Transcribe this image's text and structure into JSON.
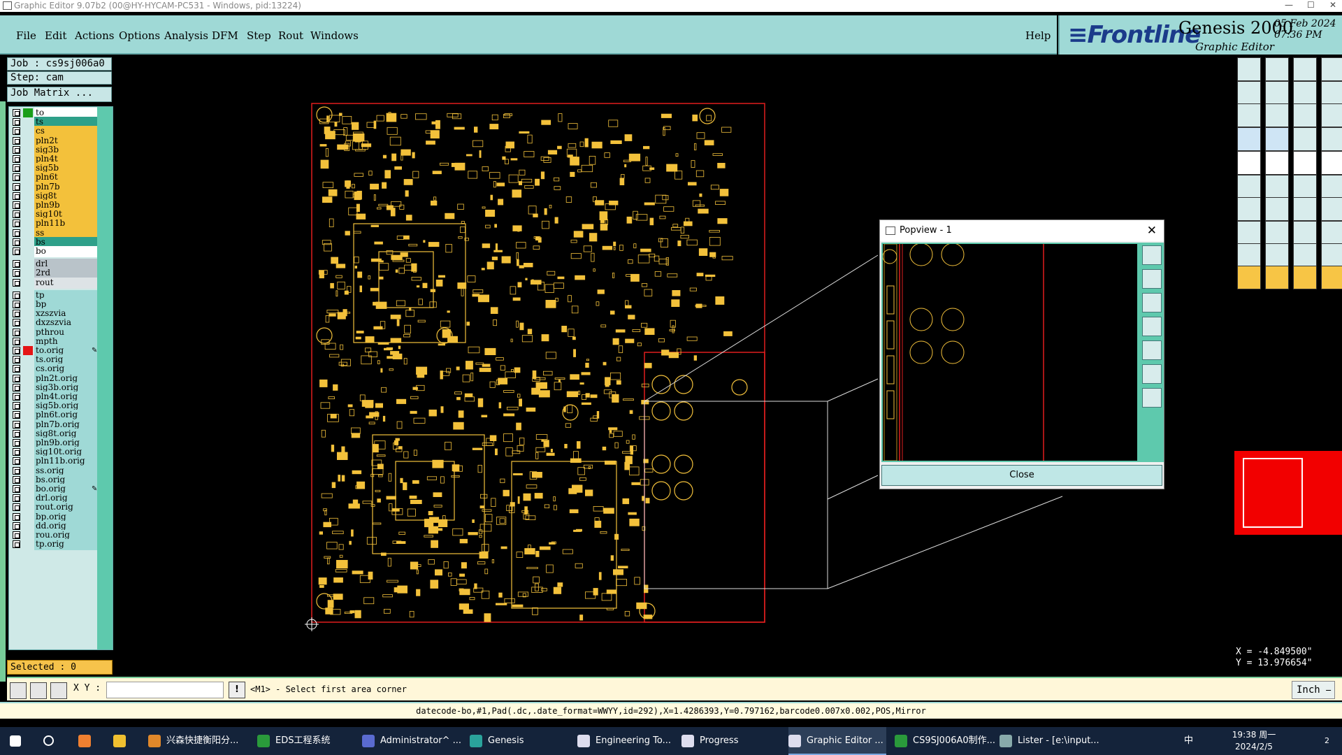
{
  "window": {
    "title": "Graphic Editor 9.07b2 (00@HY-HYCAM-PC531 - Windows, pid:13224)",
    "controls": [
      "—",
      "☐",
      "✕"
    ]
  },
  "menu": [
    "File",
    "Edit",
    "Actions",
    "Options",
    "Analysis",
    "DFM",
    "Step",
    "Rout",
    "Windows"
  ],
  "help_label": "Help",
  "brand": {
    "logo_f": "≡F",
    "logo": "rontline",
    "product": "Genesis 2000",
    "subtitle": "Graphic Editor",
    "date": "05 Feb 2024",
    "time": "07:36 PM"
  },
  "job": {
    "job": "Job : cs9sj006a0",
    "step": "Step: cam",
    "matrix": "Job Matrix ..."
  },
  "layers": [
    {
      "name": "to",
      "color": "#ffffff",
      "sw": "#1a9e1a"
    },
    {
      "name": "ts",
      "color": "#2ea089",
      "sw": ""
    },
    {
      "name": "cs",
      "color": "#f3c13b",
      "sw": ""
    },
    {
      "name": "pln2t",
      "color": "#f3c13b",
      "sw": ""
    },
    {
      "name": "sig3b",
      "color": "#f3c13b",
      "sw": ""
    },
    {
      "name": "pln4t",
      "color": "#f3c13b",
      "sw": ""
    },
    {
      "name": "sig5b",
      "color": "#f3c13b",
      "sw": ""
    },
    {
      "name": "pln6t",
      "color": "#f3c13b",
      "sw": ""
    },
    {
      "name": "pln7b",
      "color": "#f3c13b",
      "sw": ""
    },
    {
      "name": "sig8t",
      "color": "#f3c13b",
      "sw": ""
    },
    {
      "name": "pln9b",
      "color": "#f3c13b",
      "sw": ""
    },
    {
      "name": "sig10t",
      "color": "#f3c13b",
      "sw": ""
    },
    {
      "name": "pln11b",
      "color": "#f3c13b",
      "sw": ""
    },
    {
      "name": "ss",
      "color": "#f3c13b",
      "sw": ""
    },
    {
      "name": "bs",
      "color": "#2ea089",
      "sw": ""
    },
    {
      "name": "bo",
      "color": "#ffffff",
      "sw": ""
    },
    {
      "name": "drl",
      "color": "#b9c3c9",
      "sw": ""
    },
    {
      "name": "2rd",
      "color": "#b9c3c9",
      "sw": ""
    },
    {
      "name": "rout",
      "color": "#dde3e6",
      "sw": ""
    },
    {
      "name": "tp",
      "color": "#9fd9d6",
      "sw": ""
    },
    {
      "name": "bp",
      "color": "#9fd9d6",
      "sw": ""
    },
    {
      "name": "xzszvia",
      "color": "#9fd9d6",
      "sw": ""
    },
    {
      "name": "dxzszvia",
      "color": "#9fd9d6",
      "sw": ""
    },
    {
      "name": "pthrou",
      "color": "#9fd9d6",
      "sw": ""
    },
    {
      "name": "mpth",
      "color": "#9fd9d6",
      "sw": ""
    },
    {
      "name": "to.orig",
      "color": "#9fd9d6",
      "sw": "#e51515",
      "edit": "✎■"
    },
    {
      "name": "ts.orig",
      "color": "#9fd9d6",
      "sw": ""
    },
    {
      "name": "cs.orig",
      "color": "#9fd9d6",
      "sw": ""
    },
    {
      "name": "pln2t.orig",
      "color": "#9fd9d6",
      "sw": ""
    },
    {
      "name": "sig3b.orig",
      "color": "#9fd9d6",
      "sw": ""
    },
    {
      "name": "pln4t.orig",
      "color": "#9fd9d6",
      "sw": ""
    },
    {
      "name": "sig5b.orig",
      "color": "#9fd9d6",
      "sw": ""
    },
    {
      "name": "pln6t.orig",
      "color": "#9fd9d6",
      "sw": ""
    },
    {
      "name": "pln7b.orig",
      "color": "#9fd9d6",
      "sw": ""
    },
    {
      "name": "sig8t.orig",
      "color": "#9fd9d6",
      "sw": ""
    },
    {
      "name": "pln9b.orig",
      "color": "#9fd9d6",
      "sw": ""
    },
    {
      "name": "sig10t.orig",
      "color": "#9fd9d6",
      "sw": ""
    },
    {
      "name": "pln11b.orig",
      "color": "#9fd9d6",
      "sw": ""
    },
    {
      "name": "ss.orig",
      "color": "#9fd9d6",
      "sw": ""
    },
    {
      "name": "bs.orig",
      "color": "#9fd9d6",
      "sw": ""
    },
    {
      "name": "bo.orig",
      "color": "#9fd9d6",
      "sw": "",
      "edit": "✎"
    },
    {
      "name": "drl.orig",
      "color": "#9fd9d6",
      "sw": ""
    },
    {
      "name": "rout.orig",
      "color": "#9fd9d6",
      "sw": ""
    },
    {
      "name": "bp.orig",
      "color": "#9fd9d6",
      "sw": ""
    },
    {
      "name": "dd.orig",
      "color": "#9fd9d6",
      "sw": ""
    },
    {
      "name": "rou.orig",
      "color": "#9fd9d6",
      "sw": ""
    },
    {
      "name": "tp.orig",
      "color": "#9fd9d6",
      "sw": ""
    }
  ],
  "selected": "Selected : 0",
  "popview": {
    "title": "Popview - 1",
    "close_x": "✕",
    "close_button": "Close"
  },
  "coords": {
    "x": "X = -4.849500\"",
    "y": "Y = 13.976654\""
  },
  "cmd": {
    "xy_label": "X Y :",
    "xy_value": "",
    "bang": "!",
    "prompt": "<M1> - Select first area corner",
    "unit": "Inch ⎯"
  },
  "info_line": "datecode-bo,#1,Pad(.dc,.date_format=WWYY,id=292),X=1.4286393,Y=0.797162,barcode0.007x0.002,POS,Mirror",
  "colors": {
    "accent": "#9fd9d6",
    "copper": "#f3c13b",
    "outline": "#e01e1e",
    "minimap": "#f20000"
  },
  "taskbar": [
    {
      "label": "兴森快捷衡阳分...",
      "icon": "#e0882a"
    },
    {
      "label": "EDS工程系统",
      "icon": "#2a9a3b"
    },
    {
      "label": "Administrator^ ...",
      "icon": "#5a6bd0"
    },
    {
      "label": "Genesis",
      "icon": "#2aa39b"
    },
    {
      "label": "Engineering To...",
      "icon": "#dde"
    },
    {
      "label": "Progress",
      "icon": "#dde"
    },
    {
      "label": "Graphic Editor ...",
      "icon": "#dde"
    },
    {
      "label": "CS9SJ006A0制作...",
      "icon": "#2a9a3b"
    },
    {
      "label": "Lister - [e:\\input...",
      "icon": "#8aa"
    }
  ],
  "tray": {
    "lang": "中",
    "time": "19:38 周一",
    "date": "2024/2/5",
    "notifications": "2"
  }
}
